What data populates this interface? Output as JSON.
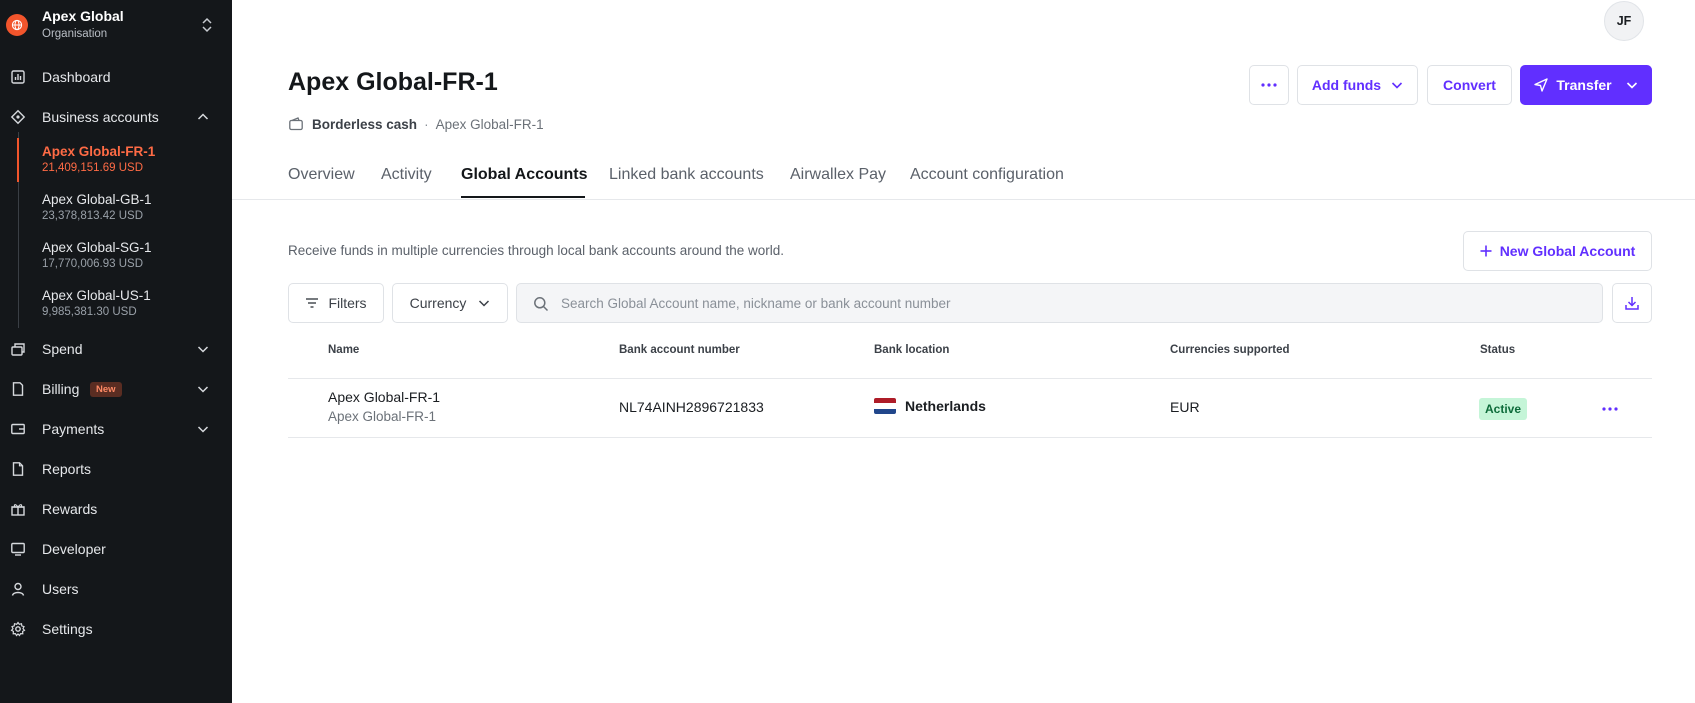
{
  "org": {
    "name": "Apex Global",
    "subtitle": "Organisation"
  },
  "sidebar": {
    "items": [
      {
        "label": "Dashboard",
        "icon": "chart-bar-icon"
      },
      {
        "label": "Business accounts",
        "icon": "accounts-icon"
      },
      {
        "label": "Spend",
        "icon": "card-icon"
      },
      {
        "label": "Billing",
        "icon": "receipt-icon",
        "badge": "New"
      },
      {
        "label": "Payments",
        "icon": "payments-icon"
      },
      {
        "label": "Reports",
        "icon": "document-icon"
      },
      {
        "label": "Rewards",
        "icon": "gift-icon"
      },
      {
        "label": "Developer",
        "icon": "monitor-icon"
      },
      {
        "label": "Users",
        "icon": "user-icon"
      },
      {
        "label": "Settings",
        "icon": "gear-icon"
      }
    ],
    "accounts": [
      {
        "name": "Apex Global-FR-1",
        "balance": "21,409,151.69 USD",
        "active": true
      },
      {
        "name": "Apex Global-GB-1",
        "balance": "23,378,813.42 USD"
      },
      {
        "name": "Apex Global-SG-1",
        "balance": "17,770,006.93 USD"
      },
      {
        "name": "Apex Global-US-1",
        "balance": "9,985,381.30 USD"
      }
    ]
  },
  "user": {
    "initials": "JF"
  },
  "header": {
    "title": "Apex Global-FR-1",
    "breadcrumb": {
      "type": "Borderless cash",
      "separator": "·",
      "account": "Apex Global-FR-1"
    },
    "actions": {
      "add_funds": "Add funds",
      "convert": "Convert",
      "transfer": "Transfer"
    }
  },
  "tabs": [
    {
      "label": "Overview"
    },
    {
      "label": "Activity"
    },
    {
      "label": "Global Accounts",
      "active": true
    },
    {
      "label": "Linked bank accounts"
    },
    {
      "label": "Airwallex Pay"
    },
    {
      "label": "Account configuration"
    }
  ],
  "global_accounts": {
    "description": "Receive funds in multiple currencies through local bank accounts around the world.",
    "new_button": "New Global Account",
    "filters_label": "Filters",
    "currency_label": "Currency",
    "search_placeholder": "Search Global Account name, nickname or bank account number",
    "columns": {
      "name": "Name",
      "account_number": "Bank account number",
      "location": "Bank location",
      "currencies": "Currencies supported",
      "status": "Status"
    },
    "rows": [
      {
        "name": "Apex Global-FR-1",
        "nickname": "Apex Global-FR-1",
        "account_number": "NL74AINH2896721833",
        "location": "Netherlands",
        "currencies": "EUR",
        "status": "Active"
      }
    ]
  },
  "colors": {
    "accent": "#612fff",
    "brand": "#f2552c",
    "sidebar_bg": "#14171a",
    "status_active_bg": "#c5f5d8"
  }
}
